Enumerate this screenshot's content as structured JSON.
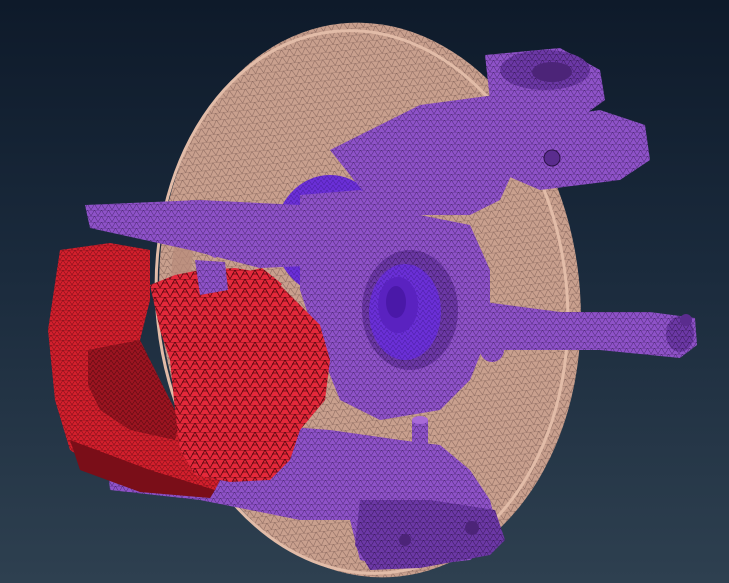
{
  "scene": {
    "description_free": true,
    "parts": [
      {
        "name": "brake-disc",
        "color": "#c9a08e"
      },
      {
        "name": "steering-knuckle",
        "color": "#8a4fc4"
      },
      {
        "name": "wheel-hub",
        "color": "#6a2fd6"
      },
      {
        "name": "brake-caliper",
        "color": "#d8202e"
      },
      {
        "name": "brake-pad-cutaway",
        "color": "#e8283a"
      }
    ],
    "background": {
      "top": "#0e1a2a",
      "bottom": "#2e4050"
    },
    "mesh_line_color": "#3a2040"
  }
}
